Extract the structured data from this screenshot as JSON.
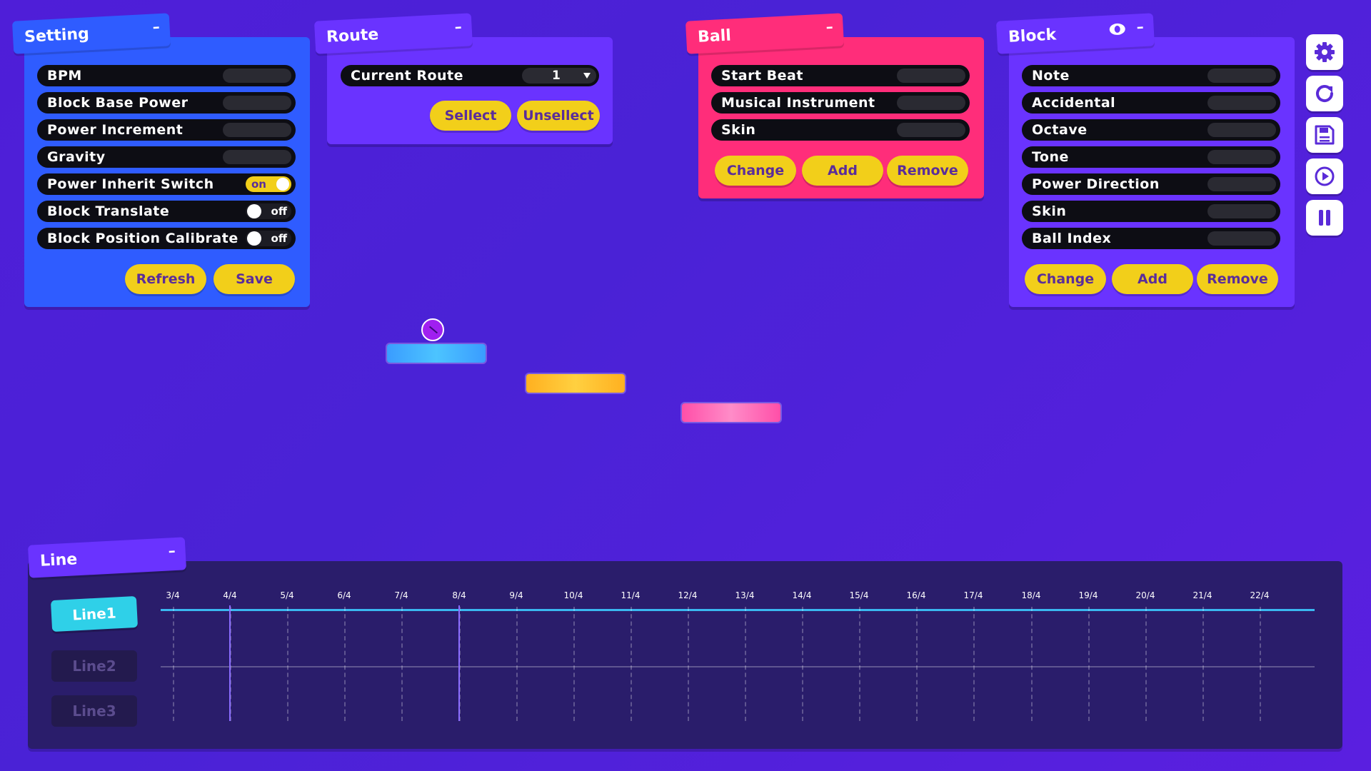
{
  "setting": {
    "title": "Setting",
    "minimize": "–",
    "rows": [
      {
        "label": "BPM"
      },
      {
        "label": "Block Base Power"
      },
      {
        "label": "Power Increment"
      },
      {
        "label": "Gravity"
      },
      {
        "label": "Power Inherit Switch",
        "toggle": "on"
      },
      {
        "label": "Block Translate",
        "toggle": "off"
      },
      {
        "label": "Block Position Calibrate",
        "toggle": "off"
      }
    ],
    "refresh_label": "Refresh",
    "save_label": "Save"
  },
  "route": {
    "title": "Route",
    "minimize": "–",
    "current_route_label": "Current Route",
    "current_route_value": "1",
    "select_label": "Sellect",
    "unselect_label": "Unsellect"
  },
  "ball": {
    "title": "Ball",
    "minimize": "–",
    "rows": [
      {
        "label": "Start Beat"
      },
      {
        "label": "Musical Instrument"
      },
      {
        "label": "Skin"
      }
    ],
    "change_label": "Change",
    "add_label": "Add",
    "remove_label": "Remove"
  },
  "block": {
    "title": "Block",
    "minimize": "–",
    "eye_icon": "eye-icon",
    "rows": [
      {
        "label": "Note"
      },
      {
        "label": "Accidental"
      },
      {
        "label": "Octave"
      },
      {
        "label": "Tone"
      },
      {
        "label": "Power Direction"
      },
      {
        "label": "Skin"
      },
      {
        "label": "Ball Index"
      }
    ],
    "change_label": "Change",
    "add_label": "Add",
    "remove_label": "Remove"
  },
  "side_toolbar": {
    "icons": [
      "gear-icon",
      "reload-icon",
      "save-icon",
      "play-icon",
      "pause-icon"
    ]
  },
  "line": {
    "title": "Line",
    "minimize": "–",
    "lines": [
      "Line1",
      "Line2",
      "Line3"
    ],
    "active_line": "Line1",
    "ticks": [
      "3/4",
      "4/4",
      "5/4",
      "6/4",
      "7/4",
      "8/4",
      "9/4",
      "10/4",
      "11/4",
      "12/4",
      "13/4",
      "14/4",
      "15/4",
      "16/4",
      "17/4",
      "18/4",
      "19/4",
      "20/4",
      "21/4",
      "22/4"
    ],
    "markers": [
      "4/4",
      "8/4"
    ]
  },
  "colors": {
    "background": "#4f1ed8",
    "setting_panel": "#2f5cff",
    "route_panel": "#6a33ff",
    "ball_panel": "#ff2d7a",
    "block_panel": "#6a33ff",
    "button_yellow": "#f2cf1a",
    "line_active": "#2fd0e8",
    "block_blue": "#3aa8ff",
    "block_orange": "#ffb020",
    "block_pink": "#ff5cb0",
    "ball": "#a020f0"
  }
}
